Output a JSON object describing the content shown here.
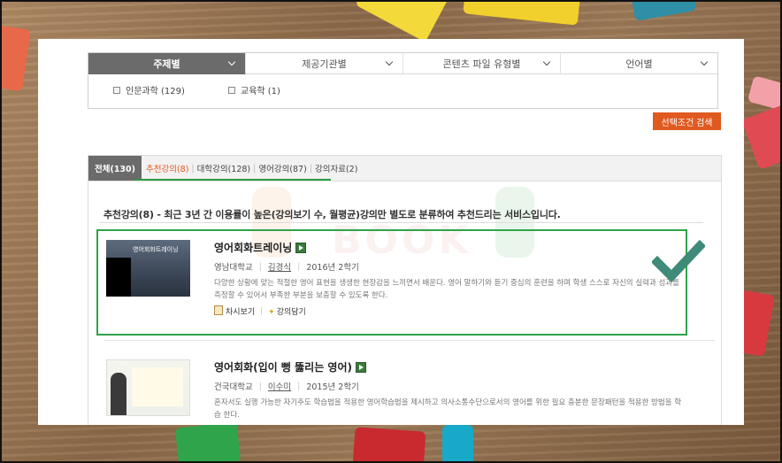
{
  "filters": {
    "tabs": [
      {
        "label": "주제별",
        "active": true
      },
      {
        "label": "제공기관별",
        "active": false
      },
      {
        "label": "콘텐츠 파일 유형별",
        "active": false
      },
      {
        "label": "언어별",
        "active": false
      }
    ],
    "options": [
      {
        "label": "인문과학 (129)"
      },
      {
        "label": "교육학 (1)"
      }
    ],
    "search_button": "선택조건 검색"
  },
  "result_tabs": {
    "all": "전체(130)",
    "subs": [
      "추천강의(8)",
      "대학강의(128)",
      "영어강의(87)",
      "강의자료(2)"
    ],
    "separators": [
      "|",
      "|",
      "|"
    ]
  },
  "intro_text": "추천강의(8) - 최근 3년 간 이용률이 높은(강의보기 수, 월평균)강의만 별도로 분류하여 추천드리는 서비스입니다.",
  "courses": [
    {
      "title": "영어회화트레이닝",
      "university": "영남대학교",
      "professor": "김경식",
      "term": "2016년 2학기",
      "description": "다양한 상황에 맞는 적절한 영어 표현을 생생한 현장감을 느끼면서 배운다. 영어 말하기와 듣기 중심의 훈련을 하며 학생 스스로 자신의 실력과 성과를 측정할 수 있어서 부족한 부분을 보충할 수 있도록 한다.",
      "thumb_caption": "영어회화트레이닝",
      "action_view": "차시보기",
      "action_save": "강의담기"
    },
    {
      "title": "영어회화(입이 뻥 뚫리는 영어)",
      "university": "건국대학교",
      "professor": "이수미",
      "term": "2015년 2학기",
      "description": "혼자서도 실행 가능한 자기주도 학습법을 적용한 영어학습법을 제시하고 의사소통수단으로서의 영어를 위한 필요 충분한 문장패턴을 적용한 방법을 학습 한다."
    }
  ],
  "watermark": "BOOK",
  "colors": {
    "accent_orange": "#e0591f",
    "highlight_green": "#2fa44a",
    "tab_active": "#6b6b6b"
  }
}
